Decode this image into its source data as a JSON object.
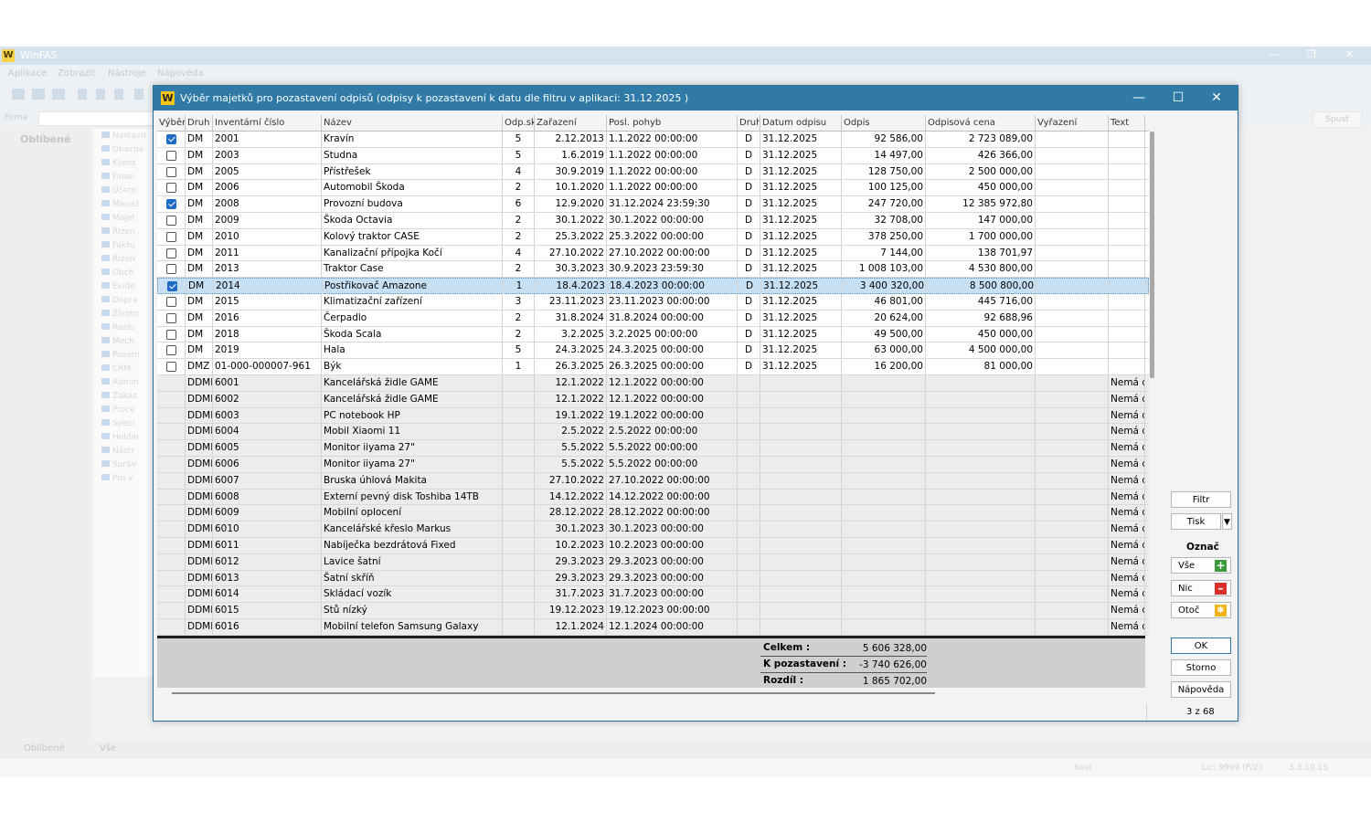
{
  "app": {
    "title": "WinFAS",
    "menu": [
      "Aplikace",
      "Zobrazit",
      "Nástroje",
      "Nápověda"
    ],
    "firma_label": "Firma :",
    "spust_label": "Spusť",
    "left_panel_title": "Oblíbené",
    "tree_items": [
      "Nastavit",
      "Obecné",
      "Klient",
      "Finan",
      "Účetn",
      "Manaž",
      "Majet",
      "Řízen",
      "Faktu",
      "Řízen",
      "Obch",
      "Evide",
      "Dopra",
      "Životn",
      "Rozlo",
      "Mech",
      "Pozem",
      "CRM",
      "Admin",
      "Zakáz",
      "Proce",
      "Speci",
      "Holdin",
      "Nástr",
      "Správ",
      "Pro v"
    ],
    "bottom_tabs": [
      "Oblíbené",
      "Vše"
    ],
    "status": {
      "user": "host",
      "lic": "Lic: 9999 (P/Z)",
      "version": "3.3.10.15"
    }
  },
  "dialog": {
    "title": "Výběr majetků pro pozastavení odpisů (odpisy k pozastavení k datu dle filtru v aplikaci: 31.12.2025 )",
    "columns": [
      "Výběr",
      "Druh",
      "Inventární číslo",
      "Název",
      "Odp.sk",
      "Zařazení",
      "Posl. pohyb",
      "Druh",
      "Datum odpisu",
      "Odpis",
      "Odpisová cena",
      "Vyřazení",
      "Text"
    ],
    "rows": [
      {
        "checked": true,
        "druh": "DM",
        "inv": "2001",
        "nazev": "Kravín",
        "odpsk": "5",
        "zarazeni": "2.12.2013",
        "pohyb": "1.1.2022 00:00:00",
        "druh2": "D",
        "datum": "31.12.2025",
        "odpis": "92 586,00",
        "cena": "2 723 089,00",
        "vyrazeni": "",
        "text": ""
      },
      {
        "checked": false,
        "druh": "DM",
        "inv": "2003",
        "nazev": "Studna",
        "odpsk": "5",
        "zarazeni": "1.6.2019",
        "pohyb": "1.1.2022 00:00:00",
        "druh2": "D",
        "datum": "31.12.2025",
        "odpis": "14 497,00",
        "cena": "426 366,00",
        "vyrazeni": "",
        "text": ""
      },
      {
        "checked": false,
        "druh": "DM",
        "inv": "2005",
        "nazev": "Přístřešek",
        "odpsk": "4",
        "zarazeni": "30.9.2019",
        "pohyb": "1.1.2022 00:00:00",
        "druh2": "D",
        "datum": "31.12.2025",
        "odpis": "128 750,00",
        "cena": "2 500 000,00",
        "vyrazeni": "",
        "text": ""
      },
      {
        "checked": false,
        "druh": "DM",
        "inv": "2006",
        "nazev": "Automobil Škoda",
        "odpsk": "2",
        "zarazeni": "10.1.2020",
        "pohyb": "1.1.2022 00:00:00",
        "druh2": "D",
        "datum": "31.12.2025",
        "odpis": "100 125,00",
        "cena": "450 000,00",
        "vyrazeni": "",
        "text": ""
      },
      {
        "checked": true,
        "druh": "DM",
        "inv": "2008",
        "nazev": "Provozní budova",
        "odpsk": "6",
        "zarazeni": "12.9.2020",
        "pohyb": "31.12.2024 23:59:30",
        "druh2": "D",
        "datum": "31.12.2025",
        "odpis": "247 720,00",
        "cena": "12 385 972,80",
        "vyrazeni": "",
        "text": ""
      },
      {
        "checked": false,
        "druh": "DM",
        "inv": "2009",
        "nazev": "Škoda Octavia",
        "odpsk": "2",
        "zarazeni": "30.1.2022",
        "pohyb": "30.1.2022 00:00:00",
        "druh2": "D",
        "datum": "31.12.2025",
        "odpis": "32 708,00",
        "cena": "147 000,00",
        "vyrazeni": "",
        "text": ""
      },
      {
        "checked": false,
        "druh": "DM",
        "inv": "2010",
        "nazev": "Kolový traktor CASE",
        "odpsk": "2",
        "zarazeni": "25.3.2022",
        "pohyb": "25.3.2022 00:00:00",
        "druh2": "D",
        "datum": "31.12.2025",
        "odpis": "378 250,00",
        "cena": "1 700 000,00",
        "vyrazeni": "",
        "text": ""
      },
      {
        "checked": false,
        "druh": "DM",
        "inv": "2011",
        "nazev": "Kanalizační přípojka Kočí",
        "odpsk": "4",
        "zarazeni": "27.10.2022",
        "pohyb": "27.10.2022 00:00:00",
        "druh2": "D",
        "datum": "31.12.2025",
        "odpis": "7 144,00",
        "cena": "138 701,97",
        "vyrazeni": "",
        "text": ""
      },
      {
        "checked": false,
        "druh": "DM",
        "inv": "2013",
        "nazev": "Traktor Case",
        "odpsk": "2",
        "zarazeni": "30.3.2023",
        "pohyb": "30.9.2023 23:59:30",
        "druh2": "D",
        "datum": "31.12.2025",
        "odpis": "1 008 103,00",
        "cena": "4 530 800,00",
        "vyrazeni": "",
        "text": ""
      },
      {
        "checked": true,
        "druh": "DM",
        "inv": "2014",
        "nazev": "Postřikovač Amazone",
        "odpsk": "1",
        "zarazeni": "18.4.2023",
        "pohyb": "18.4.2023 00:00:00",
        "druh2": "D",
        "datum": "31.12.2025",
        "odpis": "3 400 320,00",
        "cena": "8 500 800,00",
        "vyrazeni": "",
        "text": "",
        "selected": true
      },
      {
        "checked": false,
        "druh": "DM",
        "inv": "2015",
        "nazev": "Klimatizační zařízení",
        "odpsk": "3",
        "zarazeni": "23.11.2023",
        "pohyb": "23.11.2023 00:00:00",
        "druh2": "D",
        "datum": "31.12.2025",
        "odpis": "46 801,00",
        "cena": "445 716,00",
        "vyrazeni": "",
        "text": ""
      },
      {
        "checked": false,
        "druh": "DM",
        "inv": "2016",
        "nazev": "Čerpadlo",
        "odpsk": "2",
        "zarazeni": "31.8.2024",
        "pohyb": "31.8.2024 00:00:00",
        "druh2": "D",
        "datum": "31.12.2025",
        "odpis": "20 624,00",
        "cena": "92 688,96",
        "vyrazeni": "",
        "text": ""
      },
      {
        "checked": false,
        "druh": "DM",
        "inv": "2018",
        "nazev": "Škoda Scala",
        "odpsk": "2",
        "zarazeni": "3.2.2025",
        "pohyb": "3.2.2025 00:00:00",
        "druh2": "D",
        "datum": "31.12.2025",
        "odpis": "49 500,00",
        "cena": "450 000,00",
        "vyrazeni": "",
        "text": ""
      },
      {
        "checked": false,
        "druh": "DM",
        "inv": "2019",
        "nazev": "Hala",
        "odpsk": "5",
        "zarazeni": "24.3.2025",
        "pohyb": "24.3.2025 00:00:00",
        "druh2": "D",
        "datum": "31.12.2025",
        "odpis": "63 000,00",
        "cena": "4 500 000,00",
        "vyrazeni": "",
        "text": ""
      },
      {
        "checked": false,
        "druh": "DMZ",
        "inv": "01-000-000007-961",
        "nazev": "Býk",
        "odpsk": "1",
        "zarazeni": "26.3.2025",
        "pohyb": "26.3.2025 00:00:00",
        "druh2": "D",
        "datum": "31.12.2025",
        "odpis": "16 200,00",
        "cena": "81 000,00",
        "vyrazeni": "",
        "text": ""
      },
      {
        "grey": true,
        "druh": "DDMI",
        "inv": "6001",
        "nazev": "Kancelářská židle GAME",
        "odpsk": "",
        "zarazeni": "12.1.2022",
        "pohyb": "12.1.2022 00:00:00",
        "druh2": "",
        "datum": "",
        "odpis": "",
        "cena": "",
        "vyrazeni": "",
        "text": "Nemá d"
      },
      {
        "grey": true,
        "druh": "DDMI",
        "inv": "6002",
        "nazev": "Kancelářská židle GAME",
        "odpsk": "",
        "zarazeni": "12.1.2022",
        "pohyb": "12.1.2022 00:00:00",
        "druh2": "",
        "datum": "",
        "odpis": "",
        "cena": "",
        "vyrazeni": "",
        "text": "Nemá d"
      },
      {
        "grey": true,
        "druh": "DDMI",
        "inv": "6003",
        "nazev": "PC notebook HP",
        "odpsk": "",
        "zarazeni": "19.1.2022",
        "pohyb": "19.1.2022 00:00:00",
        "druh2": "",
        "datum": "",
        "odpis": "",
        "cena": "",
        "vyrazeni": "",
        "text": "Nemá d"
      },
      {
        "grey": true,
        "druh": "DDMI",
        "inv": "6004",
        "nazev": "Mobil Xiaomi 11",
        "odpsk": "",
        "zarazeni": "2.5.2022",
        "pohyb": "2.5.2022 00:00:00",
        "druh2": "",
        "datum": "",
        "odpis": "",
        "cena": "",
        "vyrazeni": "",
        "text": "Nemá d"
      },
      {
        "grey": true,
        "druh": "DDMI",
        "inv": "6005",
        "nazev": "Monitor iiyama 27\"",
        "odpsk": "",
        "zarazeni": "5.5.2022",
        "pohyb": "5.5.2022 00:00:00",
        "druh2": "",
        "datum": "",
        "odpis": "",
        "cena": "",
        "vyrazeni": "",
        "text": "Nemá d"
      },
      {
        "grey": true,
        "druh": "DDMI",
        "inv": "6006",
        "nazev": "Monitor iiyama 27\"",
        "odpsk": "",
        "zarazeni": "5.5.2022",
        "pohyb": "5.5.2022 00:00:00",
        "druh2": "",
        "datum": "",
        "odpis": "",
        "cena": "",
        "vyrazeni": "",
        "text": "Nemá d"
      },
      {
        "grey": true,
        "druh": "DDMI",
        "inv": "6007",
        "nazev": "Bruska úhlová Makita",
        "odpsk": "",
        "zarazeni": "27.10.2022",
        "pohyb": "27.10.2022 00:00:00",
        "druh2": "",
        "datum": "",
        "odpis": "",
        "cena": "",
        "vyrazeni": "",
        "text": "Nemá d"
      },
      {
        "grey": true,
        "druh": "DDMI",
        "inv": "6008",
        "nazev": "Externí pevný disk Toshiba 14TB",
        "odpsk": "",
        "zarazeni": "14.12.2022",
        "pohyb": "14.12.2022 00:00:00",
        "druh2": "",
        "datum": "",
        "odpis": "",
        "cena": "",
        "vyrazeni": "",
        "text": "Nemá d"
      },
      {
        "grey": true,
        "druh": "DDMI",
        "inv": "6009",
        "nazev": "Mobilní oplocení",
        "odpsk": "",
        "zarazeni": "28.12.2022",
        "pohyb": "28.12.2022 00:00:00",
        "druh2": "",
        "datum": "",
        "odpis": "",
        "cena": "",
        "vyrazeni": "",
        "text": "Nemá d"
      },
      {
        "grey": true,
        "druh": "DDMI",
        "inv": "6010",
        "nazev": "Kancelářské křeslo Markus",
        "odpsk": "",
        "zarazeni": "30.1.2023",
        "pohyb": "30.1.2023 00:00:00",
        "druh2": "",
        "datum": "",
        "odpis": "",
        "cena": "",
        "vyrazeni": "",
        "text": "Nemá d"
      },
      {
        "grey": true,
        "druh": "DDMI",
        "inv": "6011",
        "nazev": "Nabíječka bezdrátová Fixed",
        "odpsk": "",
        "zarazeni": "10.2.2023",
        "pohyb": "10.2.2023 00:00:00",
        "druh2": "",
        "datum": "",
        "odpis": "",
        "cena": "",
        "vyrazeni": "",
        "text": "Nemá d"
      },
      {
        "grey": true,
        "druh": "DDMI",
        "inv": "6012",
        "nazev": "Lavice šatní",
        "odpsk": "",
        "zarazeni": "29.3.2023",
        "pohyb": "29.3.2023 00:00:00",
        "druh2": "",
        "datum": "",
        "odpis": "",
        "cena": "",
        "vyrazeni": "",
        "text": "Nemá d"
      },
      {
        "grey": true,
        "druh": "DDMI",
        "inv": "6013",
        "nazev": "Šatní skříň",
        "odpsk": "",
        "zarazeni": "29.3.2023",
        "pohyb": "29.3.2023 00:00:00",
        "druh2": "",
        "datum": "",
        "odpis": "",
        "cena": "",
        "vyrazeni": "",
        "text": "Nemá d"
      },
      {
        "grey": true,
        "druh": "DDMI",
        "inv": "6014",
        "nazev": "Skládací vozík",
        "odpsk": "",
        "zarazeni": "31.7.2023",
        "pohyb": "31.7.2023 00:00:00",
        "druh2": "",
        "datum": "",
        "odpis": "",
        "cena": "",
        "vyrazeni": "",
        "text": "Nemá d"
      },
      {
        "grey": true,
        "druh": "DDMI",
        "inv": "6015",
        "nazev": "Stů nízký",
        "odpsk": "",
        "zarazeni": "19.12.2023",
        "pohyb": "19.12.2023 00:00:00",
        "druh2": "",
        "datum": "",
        "odpis": "",
        "cena": "",
        "vyrazeni": "",
        "text": "Nemá d"
      },
      {
        "grey": true,
        "druh": "DDMI",
        "inv": "6016",
        "nazev": "Mobilní telefon Samsung Galaxy",
        "odpsk": "",
        "zarazeni": "12.1.2024",
        "pohyb": "12.1.2024 00:00:00",
        "druh2": "",
        "datum": "",
        "odpis": "",
        "cena": "",
        "vyrazeni": "",
        "text": "Nemá d"
      }
    ],
    "totals": {
      "celkem_label": "Celkem :",
      "celkem": "5 606 328,00",
      "pozast_label": "K pozastavení :",
      "pozast": "-3 740 626,00",
      "rozdil_label": "Rozdíl :",
      "rozdil": "1 865 702,00"
    },
    "buttons": {
      "filtr": "Filtr",
      "tisk": "Tisk",
      "oznac": "Označ",
      "vse": "Vše",
      "nic": "Nic",
      "otoc": "Otoč",
      "ok": "OK",
      "storno": "Storno",
      "napoveda": "Nápověda"
    },
    "record_count": "3 z 68",
    "colors": {
      "titlebar": "#2f7aa7",
      "check": "#1f6bc4",
      "selected_row": "#c7dff3",
      "add_icon": "#3c9a3c",
      "remove_icon": "#d9302b",
      "toggle_icon": "#f2b318"
    }
  }
}
